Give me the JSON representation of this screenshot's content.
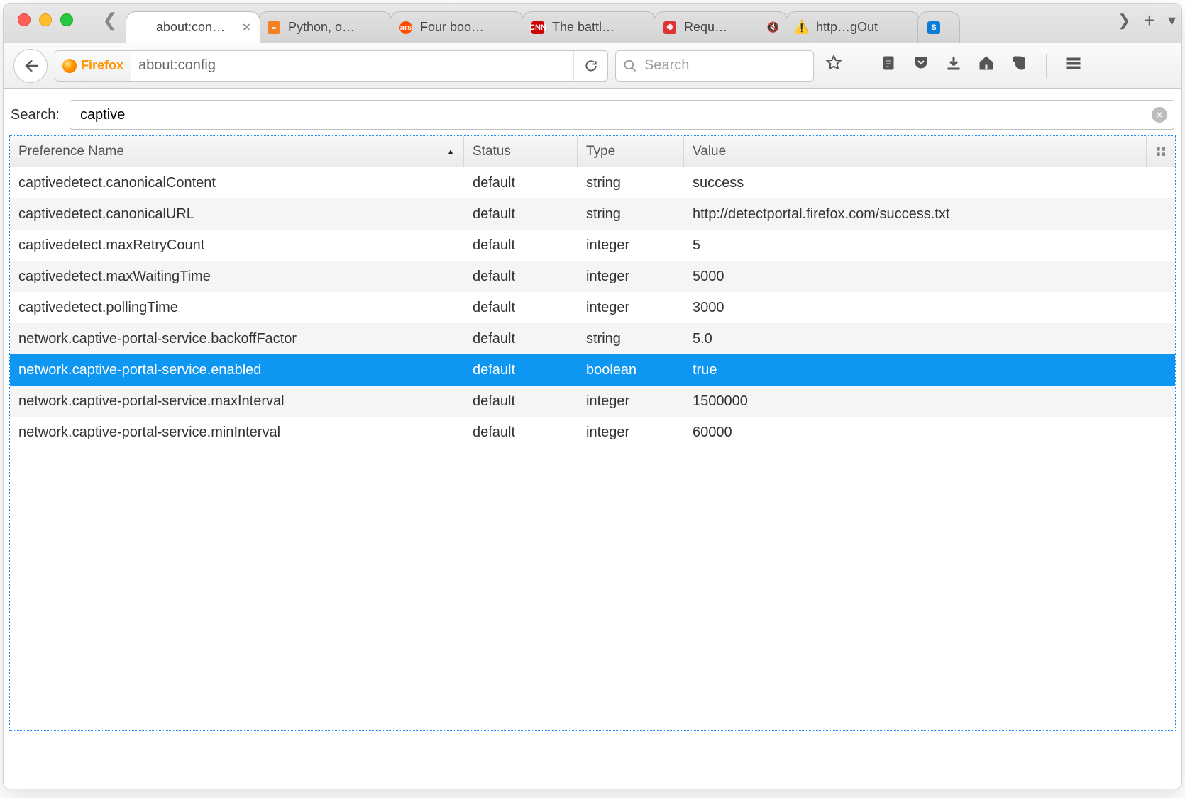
{
  "window": {
    "traffic": [
      "close",
      "minimize",
      "zoom"
    ]
  },
  "tabs": [
    {
      "title": "about:con…",
      "active": true,
      "favicon": "none"
    },
    {
      "title": "Python, o…",
      "favicon": "stackoverflow"
    },
    {
      "title": "Four boo…",
      "favicon": "ars"
    },
    {
      "title": "The battl…",
      "favicon": "cnn"
    },
    {
      "title": "Requ…",
      "favicon": "bug",
      "muted": true
    },
    {
      "title": "http…gOut",
      "favicon": "warning"
    },
    {
      "title": "",
      "favicon": "sharepoint",
      "overflow": true
    }
  ],
  "toolbar": {
    "identity_label": "Firefox",
    "url": "about:config",
    "search_placeholder": "Search"
  },
  "config": {
    "search_label": "Search:",
    "search_value": "captive",
    "columns": {
      "name": "Preference Name",
      "status": "Status",
      "type": "Type",
      "value": "Value"
    },
    "sort_column": "name",
    "selected_index": 6,
    "rows": [
      {
        "name": "captivedetect.canonicalContent",
        "status": "default",
        "type": "string",
        "value": "success"
      },
      {
        "name": "captivedetect.canonicalURL",
        "status": "default",
        "type": "string",
        "value": "http://detectportal.firefox.com/success.txt"
      },
      {
        "name": "captivedetect.maxRetryCount",
        "status": "default",
        "type": "integer",
        "value": "5"
      },
      {
        "name": "captivedetect.maxWaitingTime",
        "status": "default",
        "type": "integer",
        "value": "5000"
      },
      {
        "name": "captivedetect.pollingTime",
        "status": "default",
        "type": "integer",
        "value": "3000"
      },
      {
        "name": "network.captive-portal-service.backoffFactor",
        "status": "default",
        "type": "string",
        "value": "5.0"
      },
      {
        "name": "network.captive-portal-service.enabled",
        "status": "default",
        "type": "boolean",
        "value": "true"
      },
      {
        "name": "network.captive-portal-service.maxInterval",
        "status": "default",
        "type": "integer",
        "value": "1500000"
      },
      {
        "name": "network.captive-portal-service.minInterval",
        "status": "default",
        "type": "integer",
        "value": "60000"
      }
    ]
  }
}
